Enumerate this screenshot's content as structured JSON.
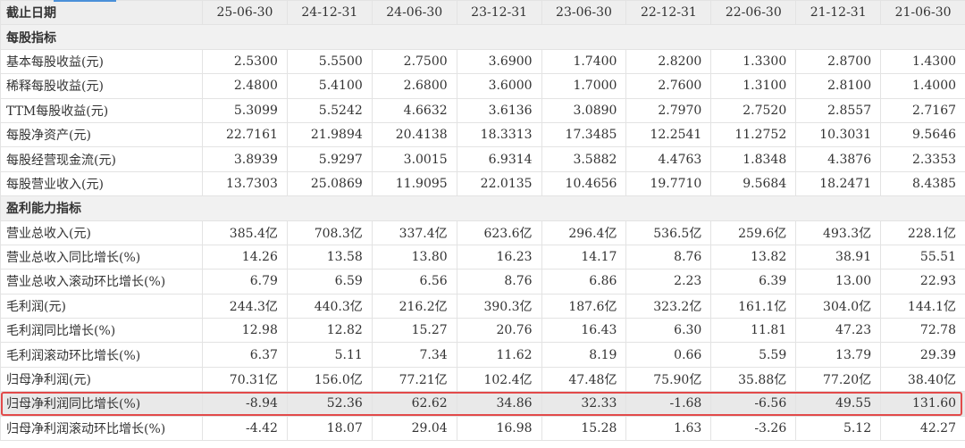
{
  "header": {
    "first": "截止日期",
    "dates": [
      "25-06-30",
      "24-12-31",
      "24-06-30",
      "23-12-31",
      "23-06-30",
      "22-12-31",
      "22-06-30",
      "21-12-31",
      "21-06-30"
    ]
  },
  "sections": [
    {
      "title": "每股指标",
      "rows": [
        {
          "label": "基本每股收益(元)",
          "values": [
            "2.5300",
            "5.5500",
            "2.7500",
            "3.6900",
            "1.7400",
            "2.8200",
            "1.3300",
            "2.8700",
            "1.4300"
          ]
        },
        {
          "label": "稀释每股收益(元)",
          "values": [
            "2.4800",
            "5.4100",
            "2.6800",
            "3.6000",
            "1.7000",
            "2.7600",
            "1.3100",
            "2.8100",
            "1.4000"
          ]
        },
        {
          "label": "TTM每股收益(元)",
          "values": [
            "5.3099",
            "5.5242",
            "4.6632",
            "3.6136",
            "3.0890",
            "2.7970",
            "2.7520",
            "2.8557",
            "2.7167"
          ]
        },
        {
          "label": "每股净资产(元)",
          "values": [
            "22.7161",
            "21.9894",
            "20.4138",
            "18.3313",
            "17.3485",
            "12.2541",
            "11.2752",
            "10.3031",
            "9.5646"
          ]
        },
        {
          "label": "每股经营现金流(元)",
          "values": [
            "3.8939",
            "5.9297",
            "3.0015",
            "6.9314",
            "3.5882",
            "4.4763",
            "1.8348",
            "4.3876",
            "2.3353"
          ]
        },
        {
          "label": "每股营业收入(元)",
          "values": [
            "13.7303",
            "25.0869",
            "11.9095",
            "22.0135",
            "10.4656",
            "19.7710",
            "9.5684",
            "18.2471",
            "8.4385"
          ]
        }
      ]
    },
    {
      "title": "盈利能力指标",
      "rows": [
        {
          "label": "营业总收入(元)",
          "values": [
            "385.4亿",
            "708.3亿",
            "337.4亿",
            "623.6亿",
            "296.4亿",
            "536.5亿",
            "259.6亿",
            "493.3亿",
            "228.1亿"
          ]
        },
        {
          "label": "营业总收入同比增长(%)",
          "values": [
            "14.26",
            "13.58",
            "13.80",
            "16.23",
            "14.17",
            "8.76",
            "13.82",
            "38.91",
            "55.51"
          ]
        },
        {
          "label": "营业总收入滚动环比增长(%)",
          "values": [
            "6.79",
            "6.59",
            "6.56",
            "8.76",
            "6.86",
            "2.23",
            "6.39",
            "13.00",
            "22.93"
          ]
        },
        {
          "label": "毛利润(元)",
          "values": [
            "244.3亿",
            "440.3亿",
            "216.2亿",
            "390.3亿",
            "187.6亿",
            "323.2亿",
            "161.1亿",
            "304.0亿",
            "144.1亿"
          ]
        },
        {
          "label": "毛利润同比增长(%)",
          "values": [
            "12.98",
            "12.82",
            "15.27",
            "20.76",
            "16.43",
            "6.30",
            "11.81",
            "47.23",
            "72.78"
          ]
        },
        {
          "label": "毛利润滚动环比增长(%)",
          "values": [
            "6.37",
            "5.11",
            "7.34",
            "11.62",
            "8.19",
            "0.66",
            "5.59",
            "13.79",
            "29.39"
          ]
        },
        {
          "label": "归母净利润(元)",
          "values": [
            "70.31亿",
            "156.0亿",
            "77.21亿",
            "102.4亿",
            "47.48亿",
            "75.90亿",
            "35.88亿",
            "77.20亿",
            "38.40亿"
          ]
        },
        {
          "label": "归母净利润同比增长(%)",
          "highlight": true,
          "values": [
            "-8.94",
            "52.36",
            "62.62",
            "34.86",
            "32.33",
            "-1.68",
            "-6.56",
            "49.55",
            "131.60"
          ]
        },
        {
          "label": "归母净利润滚动环比增长(%)",
          "values": [
            "-4.42",
            "18.07",
            "29.04",
            "16.98",
            "15.28",
            "1.63",
            "-3.26",
            "5.12",
            "42.27"
          ]
        }
      ]
    }
  ],
  "colors": {
    "highlight_border": "#e24a4a",
    "header_bg": "#eeeeee",
    "section_bg": "#f1f1f1",
    "accent": "#4a90d9"
  }
}
